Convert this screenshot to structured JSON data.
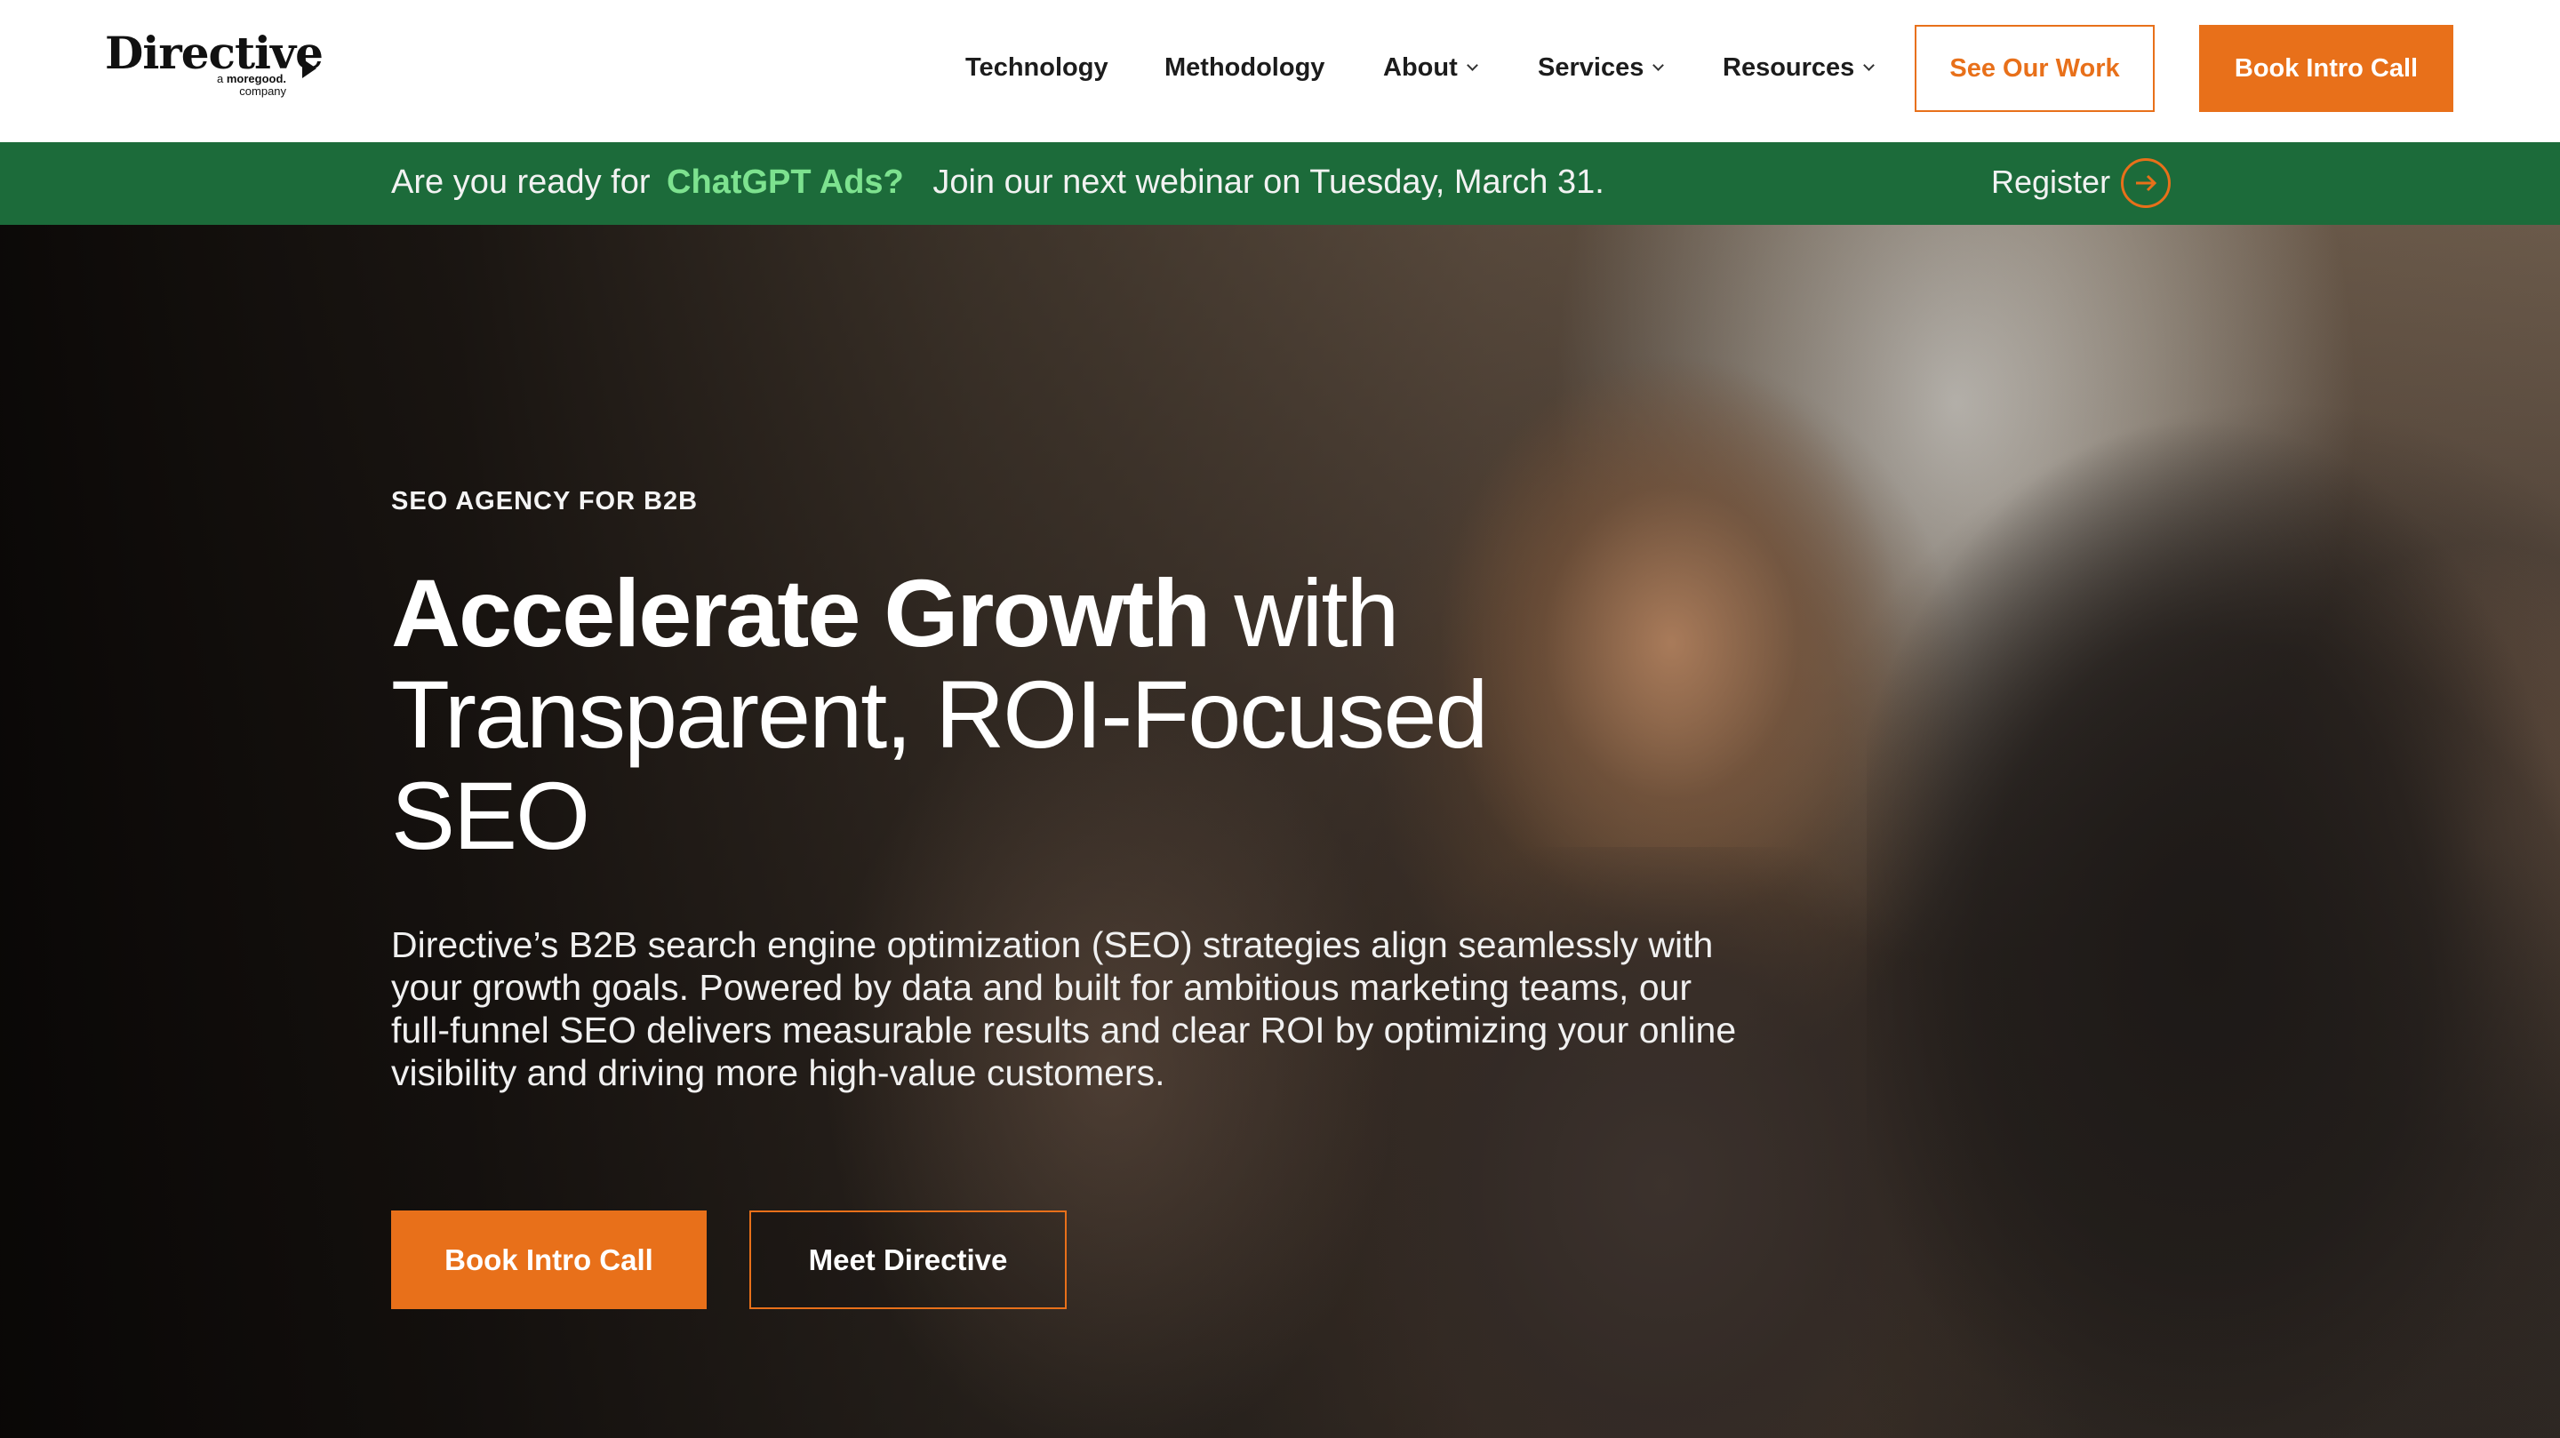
{
  "header": {
    "logo": {
      "wordmark": "Directive",
      "sub_line1_prefix": "a",
      "sub_line1_brand": "moregood.",
      "sub_line2": "company"
    },
    "nav": [
      {
        "label": "Technology",
        "has_dropdown": false
      },
      {
        "label": "Methodology",
        "has_dropdown": false
      },
      {
        "label": "About",
        "has_dropdown": true
      },
      {
        "label": "Services",
        "has_dropdown": true
      },
      {
        "label": "Resources",
        "has_dropdown": true
      }
    ],
    "see_work_label": "See Our Work",
    "book_call_label": "Book Intro Call"
  },
  "banner": {
    "lead": "Are you ready for",
    "highlight": "ChatGPT Ads?",
    "message": "Join our next webinar on Tuesday, March 31.",
    "register_label": "Register"
  },
  "hero": {
    "eyebrow": "SEO AGENCY FOR B2B",
    "headline_bold": "Accelerate Growth",
    "headline_rest_1": "with",
    "headline_line2": "Transparent, ROI-Focused",
    "headline_line3": "SEO",
    "description": "Directive’s B2B search engine optimization (SEO) strategies align seamlessly with your growth goals. Powered by data and built for ambitious marketing teams, our full-funnel SEO delivers measurable results and clear ROI by optimizing your online visibility and driving more high-value customers.",
    "primary_cta": "Book Intro Call",
    "secondary_cta": "Meet Directive"
  },
  "colors": {
    "accent_orange": "#e8701a",
    "banner_green": "#1c6b3a",
    "banner_highlight": "#7de28f"
  },
  "icons": {
    "register": "arrow-right-circle-icon",
    "dropdown": "chevron-down-icon"
  }
}
